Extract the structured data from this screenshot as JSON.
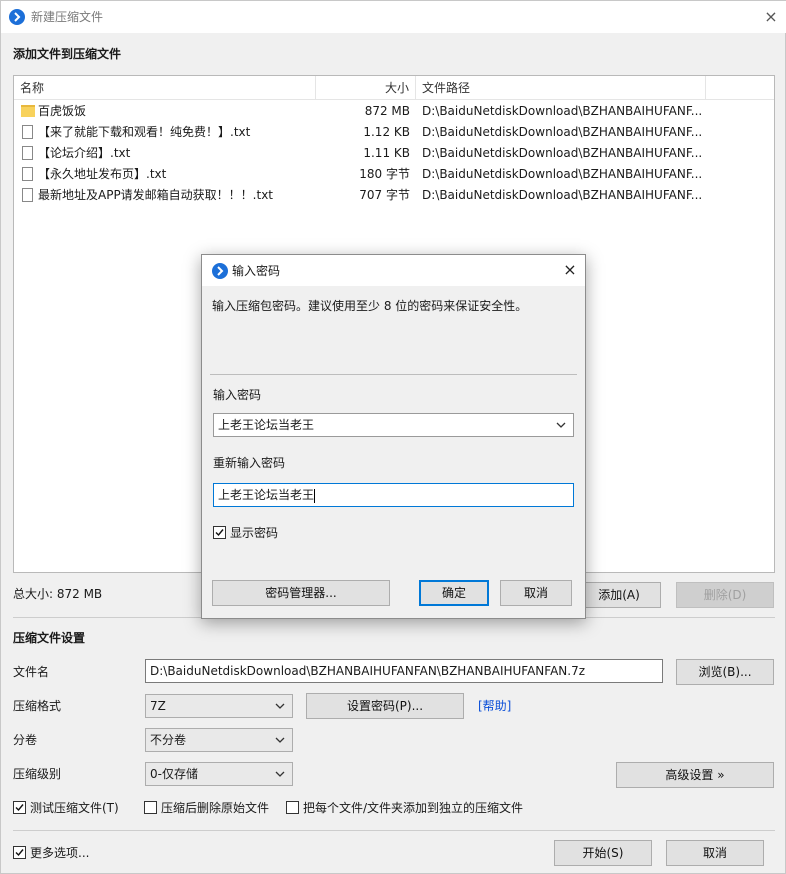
{
  "window": {
    "title": "新建压缩文件",
    "close_glyph": "×",
    "accent_color": "#1c6fd8"
  },
  "files_section": {
    "heading": "添加文件到压缩文件",
    "columns": {
      "name": "名称",
      "size": "大小",
      "path": "文件路径"
    },
    "rows": [
      {
        "icon": "folder-icon",
        "name": "百虎饭饭",
        "size": "872 MB",
        "path": "D:\\BaiduNetdiskDownload\\BZHANBAIHUFANF..."
      },
      {
        "icon": "document-icon",
        "name": "【来了就能下载和观看！纯免费！】.txt",
        "size": "1.12 KB",
        "path": "D:\\BaiduNetdiskDownload\\BZHANBAIHUFANF..."
      },
      {
        "icon": "document-icon",
        "name": "【论坛介绍】.txt",
        "size": "1.11 KB",
        "path": "D:\\BaiduNetdiskDownload\\BZHANBAIHUFANF..."
      },
      {
        "icon": "document-icon",
        "name": "【永久地址发布页】.txt",
        "size": "180 字节",
        "path": "D:\\BaiduNetdiskDownload\\BZHANBAIHUFANF..."
      },
      {
        "icon": "document-icon",
        "name": "最新地址及APP请发邮箱自动获取！！！.txt",
        "size": "707 字节",
        "path": "D:\\BaiduNetdiskDownload\\BZHANBAIHUFANF..."
      }
    ],
    "total_size": "总大小: 872 MB",
    "add_button": "添加(A)",
    "delete_button": "删除(D)"
  },
  "settings": {
    "heading": "压缩文件设置",
    "filename_label": "文件名",
    "filename_value": "D:\\BaiduNetdiskDownload\\BZHANBAIHUFANFAN\\BZHANBAIHUFANFAN.7z",
    "browse_button": "浏览(B)...",
    "format_label": "压缩格式",
    "format_value": "7Z",
    "set_password_button": "设置密码(P)...",
    "help_link": "[帮助]",
    "split_label": "分卷",
    "split_value": "不分卷",
    "level_label": "压缩级别",
    "level_value": "0-仅存储",
    "advanced_button": "高级设置 »",
    "test_archive": {
      "label": "测试压缩文件(T)",
      "checked": true
    },
    "delete_after": {
      "label": "压缩后删除原始文件",
      "checked": false
    },
    "separate_archives": {
      "label": "把每个文件/文件夹添加到独立的压缩文件",
      "checked": false
    }
  },
  "footer": {
    "more_options": {
      "label": "更多选项...",
      "checked": true
    },
    "start_button": "开始(S)",
    "cancel_button": "取消"
  },
  "password_dialog": {
    "title": "输入密码",
    "close_glyph": "×",
    "description": "输入压缩包密码。建议使用至少 8 位的密码来保证安全性。",
    "password_label": "输入密码",
    "password_value": "上老王论坛当老王",
    "confirm_label": "重新输入密码",
    "confirm_value": "上老王论坛当老王",
    "show_password": {
      "label": "显示密码",
      "checked": true
    },
    "manager_button": "密码管理器...",
    "ok_button": "确定",
    "cancel_button": "取消"
  }
}
